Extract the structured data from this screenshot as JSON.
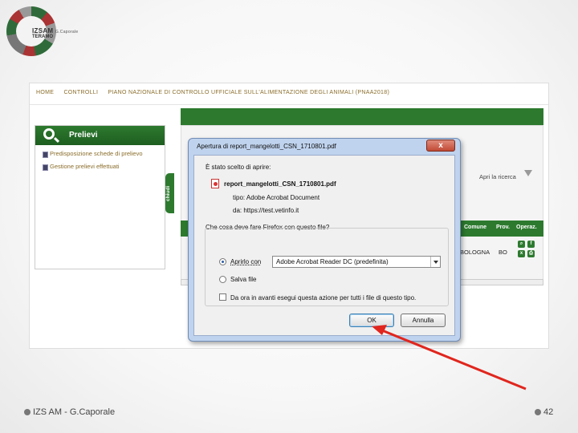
{
  "logo": {
    "line1": "IZSAM",
    "line1_small": "G.Caporale",
    "line2": "TERAMO"
  },
  "nav": {
    "home": "HOME",
    "controlli": "CONTROLLI",
    "piano": "PIANO NAZIONALE DI CONTROLLO UFFICIALE SULL'ALIMENTAZIONE DEGLI ANIMALI (PNAA2018)"
  },
  "sidebar": {
    "title": "Prelievi",
    "items": [
      {
        "label": "Predisposizione schede di prelievo"
      },
      {
        "label": "Gestione prelievi effettuati"
      }
    ],
    "chiudi": "chiudi"
  },
  "background_page": {
    "search_label": "Apri la ricerca",
    "columns": [
      "Comune",
      "Prov.",
      "Operaz."
    ],
    "row": {
      "comune": "BOLOGNA",
      "prov": "BO"
    }
  },
  "dialog": {
    "title": "Apertura di report_mangelotti_CSN_1710801.pdf",
    "intro": "È stato scelto di aprire:",
    "filename": "report_mangelotti_CSN_1710801.pdf",
    "type_label": "tipo:",
    "type_value": "Adobe Acrobat Document",
    "from_label": "da:",
    "from_value": "https://test.vetinfo.it",
    "question": "Che cosa deve fare Firefox con questo file?",
    "open_with_label": "Aprirlo con",
    "open_with_value": "Adobe Acrobat Reader DC (predefinita)",
    "save_label": "Salva file",
    "remember_label": "Da ora in avanti esegui questa azione per tutti i file di questo tipo.",
    "ok_label": "OK",
    "cancel_label": "Annulla",
    "close_glyph": "x"
  },
  "footer": {
    "left": "IZS AM  -  G.Caporale",
    "page": "42"
  },
  "colors": {
    "green": "#2d7a2f",
    "arrow": "#e0261e"
  }
}
